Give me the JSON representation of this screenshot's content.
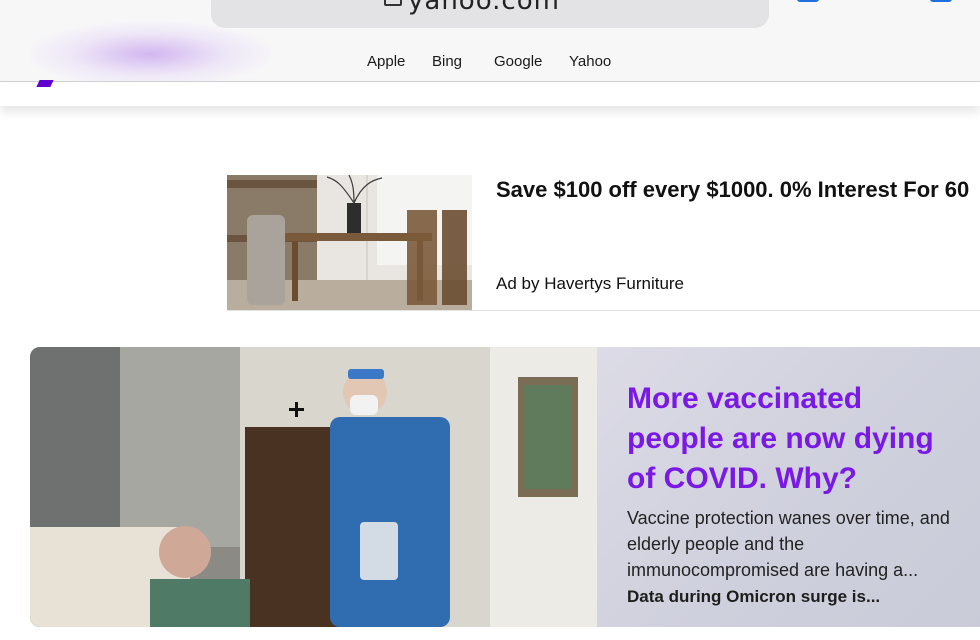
{
  "browser": {
    "url": "yahoo.com",
    "favorites": [
      "Apple",
      "Bing",
      "Google",
      "Yahoo"
    ]
  },
  "ad": {
    "title": "Save $100 off every $1000. 0% Interest For 60",
    "sponsor": "Ad by Havertys Furniture",
    "image_icon": "dining-room-photo"
  },
  "hero": {
    "title": "More vaccinated people are now dying of COVID. Why?",
    "summary": "Vaccine protection wanes over time, and elderly people and the immunocompromised are having a...",
    "more": "Data during Omicron surge is...",
    "image_icon": "hospital-room-photo",
    "accent_color": "#7a19e6"
  },
  "brand": {
    "color": "#6001d2"
  }
}
